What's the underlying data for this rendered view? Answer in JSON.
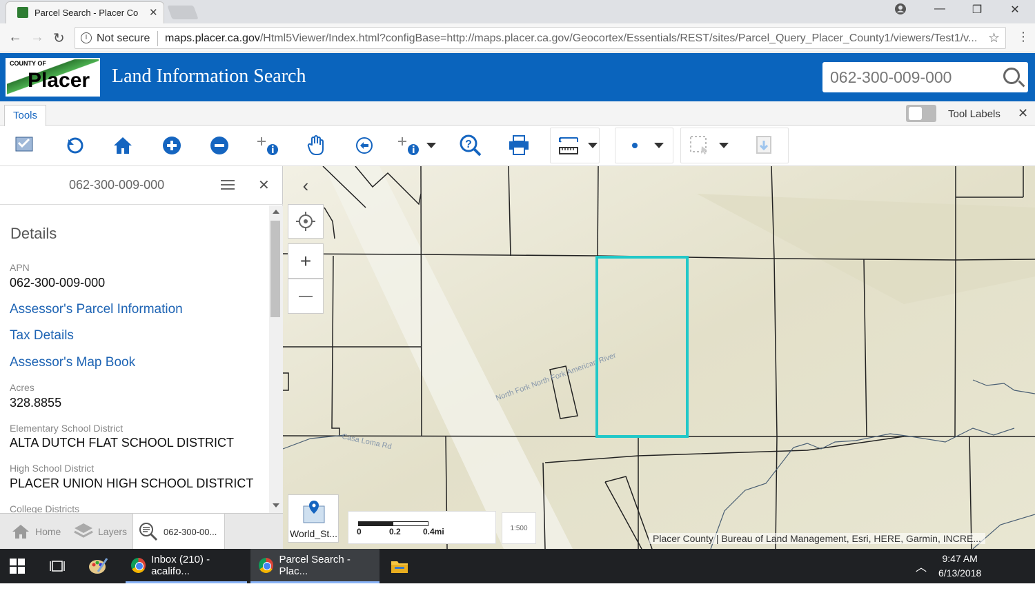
{
  "browser": {
    "tab_title": "Parcel Search - Placer Co",
    "security": "Not secure",
    "url_host": "maps.placer.ca.gov",
    "url_rest": "/Html5Viewer/Index.html?configBase=http://maps.placer.ca.gov/Geocortex/Essentials/REST/sites/Parcel_Query_Placer_County1/viewers/Test1/v..."
  },
  "header": {
    "logo_county": "COUNTY OF",
    "logo_name": "Placer",
    "title": "Land Information Search",
    "search_value": "062-300-009-000"
  },
  "tabrow": {
    "tools_tab": "Tools",
    "tool_labels": "Tool Labels",
    "close": "✕"
  },
  "toolbar": {
    "icons": [
      "map-info-icon",
      "refresh-icon",
      "home-icon",
      "zoom-in-icon",
      "zoom-out-icon",
      "identify-icon",
      "pan-icon",
      "previous-extent-icon",
      "identify-dropdown-icon",
      "help-icon",
      "print-icon",
      "measure-icon",
      "draw-point-icon",
      "select-icon",
      "export-icon"
    ]
  },
  "panel": {
    "title": "062-300-009-000",
    "close": "✕",
    "details_heading": "Details",
    "apn_label": "APN",
    "apn_value": "062-300-009-000",
    "link_parcel_info": "Assessor's Parcel Information",
    "link_tax": "Tax Details",
    "link_map_book": "Assessor's Map Book",
    "acres_label": "Acres",
    "acres_value": "328.8855",
    "elem_label": "Elementary School District",
    "elem_value": "ALTA DUTCH FLAT SCHOOL DISTRICT",
    "high_label": "High School District",
    "high_value": "PLACER UNION HIGH SCHOOL DISTRICT",
    "college_label": "College Districts",
    "tabs": [
      {
        "label": "Home"
      },
      {
        "label": "Layers"
      },
      {
        "label": "062-300-00..."
      }
    ]
  },
  "map": {
    "collapse": "‹",
    "zoom_in": "+",
    "zoom_out": "—",
    "road_label_1": "North Fork North Fork American River",
    "road_label_2": "Casa Loma Rd",
    "basemap_label": "World_St...",
    "scale_ticks": [
      "0",
      "0.2",
      "0.4mi"
    ],
    "scale_tool": "1:500",
    "attribution": "Placer County | Bureau of Land Management, Esri, HERE, Garmin, INCRE...",
    "highlight_color": "#22c8c8"
  },
  "taskbar": {
    "items": [
      {
        "label": "Inbox (210) - acalifo..."
      },
      {
        "label": "Parcel Search - Plac..."
      }
    ],
    "time": "9:47 AM",
    "date": "6/13/2018"
  }
}
